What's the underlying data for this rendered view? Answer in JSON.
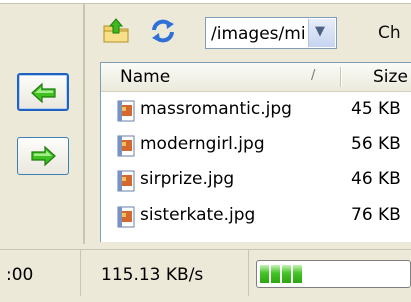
{
  "toolbar": {
    "path_value": "/images/mi",
    "trailing_label": "Ch",
    "up_icon": "folder-up-icon",
    "refresh_icon": "refresh-icon"
  },
  "nav": {
    "back_icon": "green-arrow-left-icon",
    "forward_icon": "green-arrow-right-icon"
  },
  "filelist": {
    "columns": {
      "name": "Name",
      "sort_indicator": "/",
      "size": "Size"
    },
    "files": [
      {
        "name": "massromantic.jpg",
        "size": "45 KB"
      },
      {
        "name": "moderngirl.jpg",
        "size": "56 KB"
      },
      {
        "name": "sirprize.jpg",
        "size": "46 KB"
      },
      {
        "name": "sisterkate.jpg",
        "size": "76 KB"
      }
    ]
  },
  "statusbar": {
    "time": ":00",
    "speed": "115.13 KB/s",
    "progress_fraction": 0.33
  },
  "colors": {
    "accent_green": "#43c425",
    "selection_blue": "#1f63c2"
  }
}
